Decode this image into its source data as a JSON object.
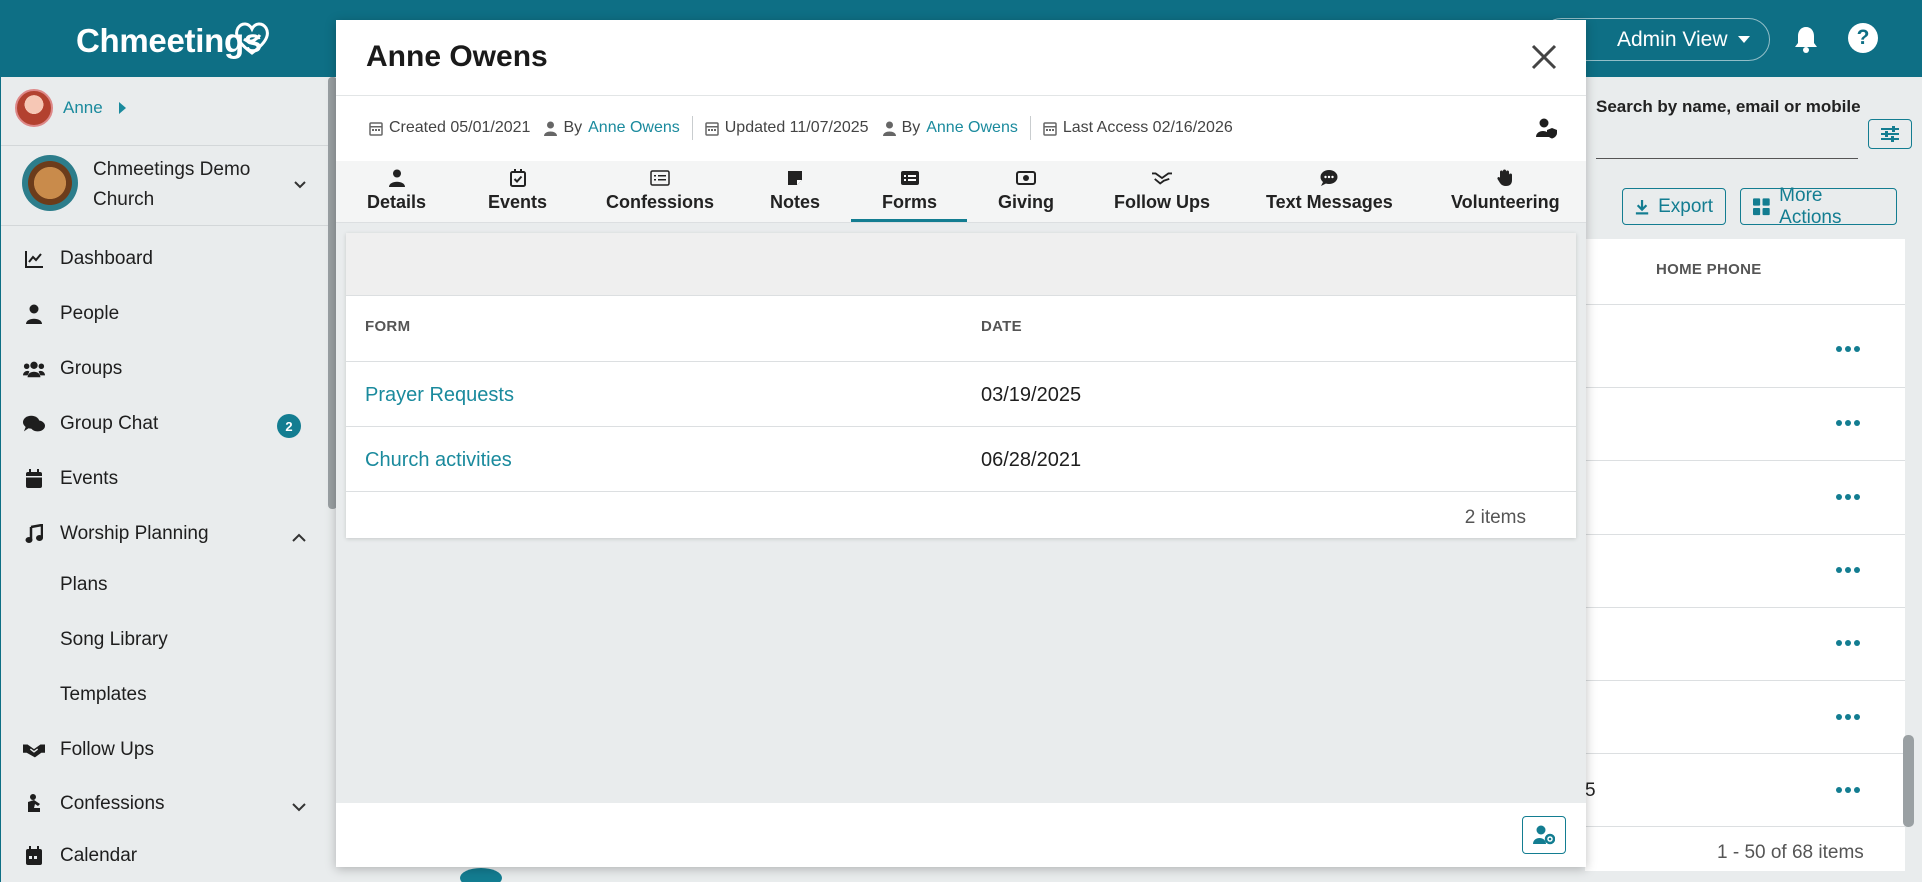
{
  "app": {
    "logo_text": "Chmeetings",
    "admin_view_label": "Admin View",
    "help_label": "?"
  },
  "sidebar": {
    "user_name": "Anne",
    "church_name": "Chmeetings Demo Church",
    "items": [
      {
        "label": "Dashboard",
        "icon": "chart-line-icon"
      },
      {
        "label": "People",
        "icon": "person-icon"
      },
      {
        "label": "Groups",
        "icon": "users-icon"
      },
      {
        "label": "Group Chat",
        "icon": "comments-icon",
        "badge": "2"
      },
      {
        "label": "Events",
        "icon": "calendar-icon"
      },
      {
        "label": "Worship Planning",
        "icon": "music-icon",
        "expanded": true
      },
      {
        "label": "Follow Ups",
        "icon": "handshake-icon"
      },
      {
        "label": "Confessions",
        "icon": "praying-icon",
        "expanded": false
      },
      {
        "label": "Calendar",
        "icon": "calendar-alt-icon"
      }
    ],
    "worship_sub_items": [
      "Plans",
      "Song Library",
      "Templates"
    ]
  },
  "background_page": {
    "search_label": "Search by name, email or mobile",
    "export_label": "Export",
    "more_actions_label": "More Actions",
    "column_header": "HOME PHONE",
    "partial_cell": "5",
    "pagination": "1 - 50 of 68 items"
  },
  "modal": {
    "title": "Anne Owens",
    "meta": {
      "created": "Created 05/01/2021",
      "created_by_prefix": "By",
      "created_by": "Anne Owens",
      "updated": "Updated 11/07/2025",
      "updated_by_prefix": "By",
      "updated_by": "Anne Owens",
      "last_access": "Last Access 02/16/2026"
    },
    "tabs": [
      {
        "label": "Details",
        "icon": "person-icon"
      },
      {
        "label": "Events",
        "icon": "calendar-check-icon"
      },
      {
        "label": "Confessions",
        "icon": "list-icon"
      },
      {
        "label": "Notes",
        "icon": "sticky-note-icon"
      },
      {
        "label": "Forms",
        "icon": "form-icon",
        "active": true
      },
      {
        "label": "Giving",
        "icon": "money-icon"
      },
      {
        "label": "Follow Ups",
        "icon": "handshake-icon"
      },
      {
        "label": "Text Messages",
        "icon": "chat-icon"
      },
      {
        "label": "Volunteering",
        "icon": "hand-icon"
      }
    ],
    "table": {
      "columns": [
        "FORM",
        "DATE"
      ],
      "rows": [
        {
          "form": "Prayer Requests",
          "date": "03/19/2025"
        },
        {
          "form": "Church activities",
          "date": "06/28/2021"
        }
      ],
      "items_count": "2 items"
    }
  },
  "colors": {
    "primary": "#0e6f85",
    "accent": "#137d91",
    "link": "#1a8a9d"
  }
}
